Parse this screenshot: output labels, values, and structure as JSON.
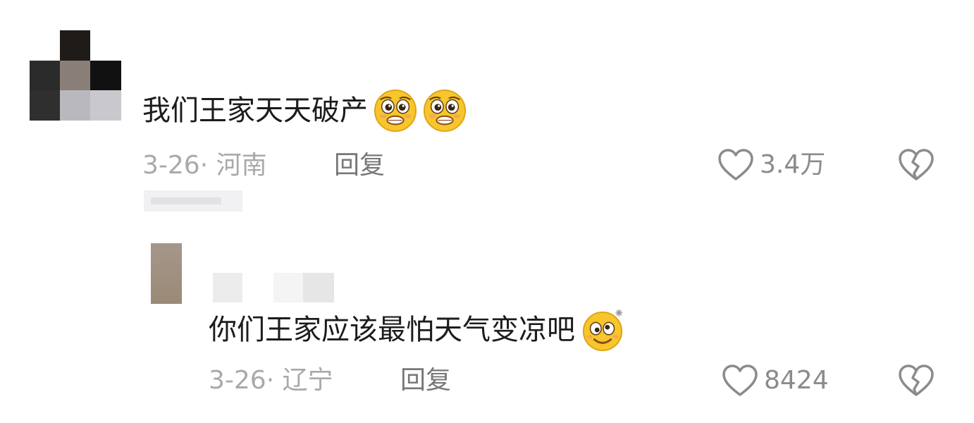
{
  "comments": [
    {
      "text": "我们王家天天破产",
      "emoji_icons": [
        "pleading-face-icon",
        "pleading-face-icon"
      ],
      "date_location": "3-26· 河南",
      "reply_label": "回复",
      "like_count": "3.4万"
    },
    {
      "text": "你们王家应该最怕天气变凉吧",
      "emoji_icons": [
        "dazed-smile-face-icon"
      ],
      "date_location": "3-26· 辽宁",
      "reply_label": "回复",
      "like_count": "8424"
    }
  ],
  "icons": {
    "like": "heart-outline-icon",
    "dislike": "broken-heart-icon"
  },
  "colors": {
    "text": "#1c1c1c",
    "meta": "#a9a9a9",
    "reply": "#777777",
    "icon": "#8b8b8b",
    "emoji_face": "#f7c52c"
  }
}
